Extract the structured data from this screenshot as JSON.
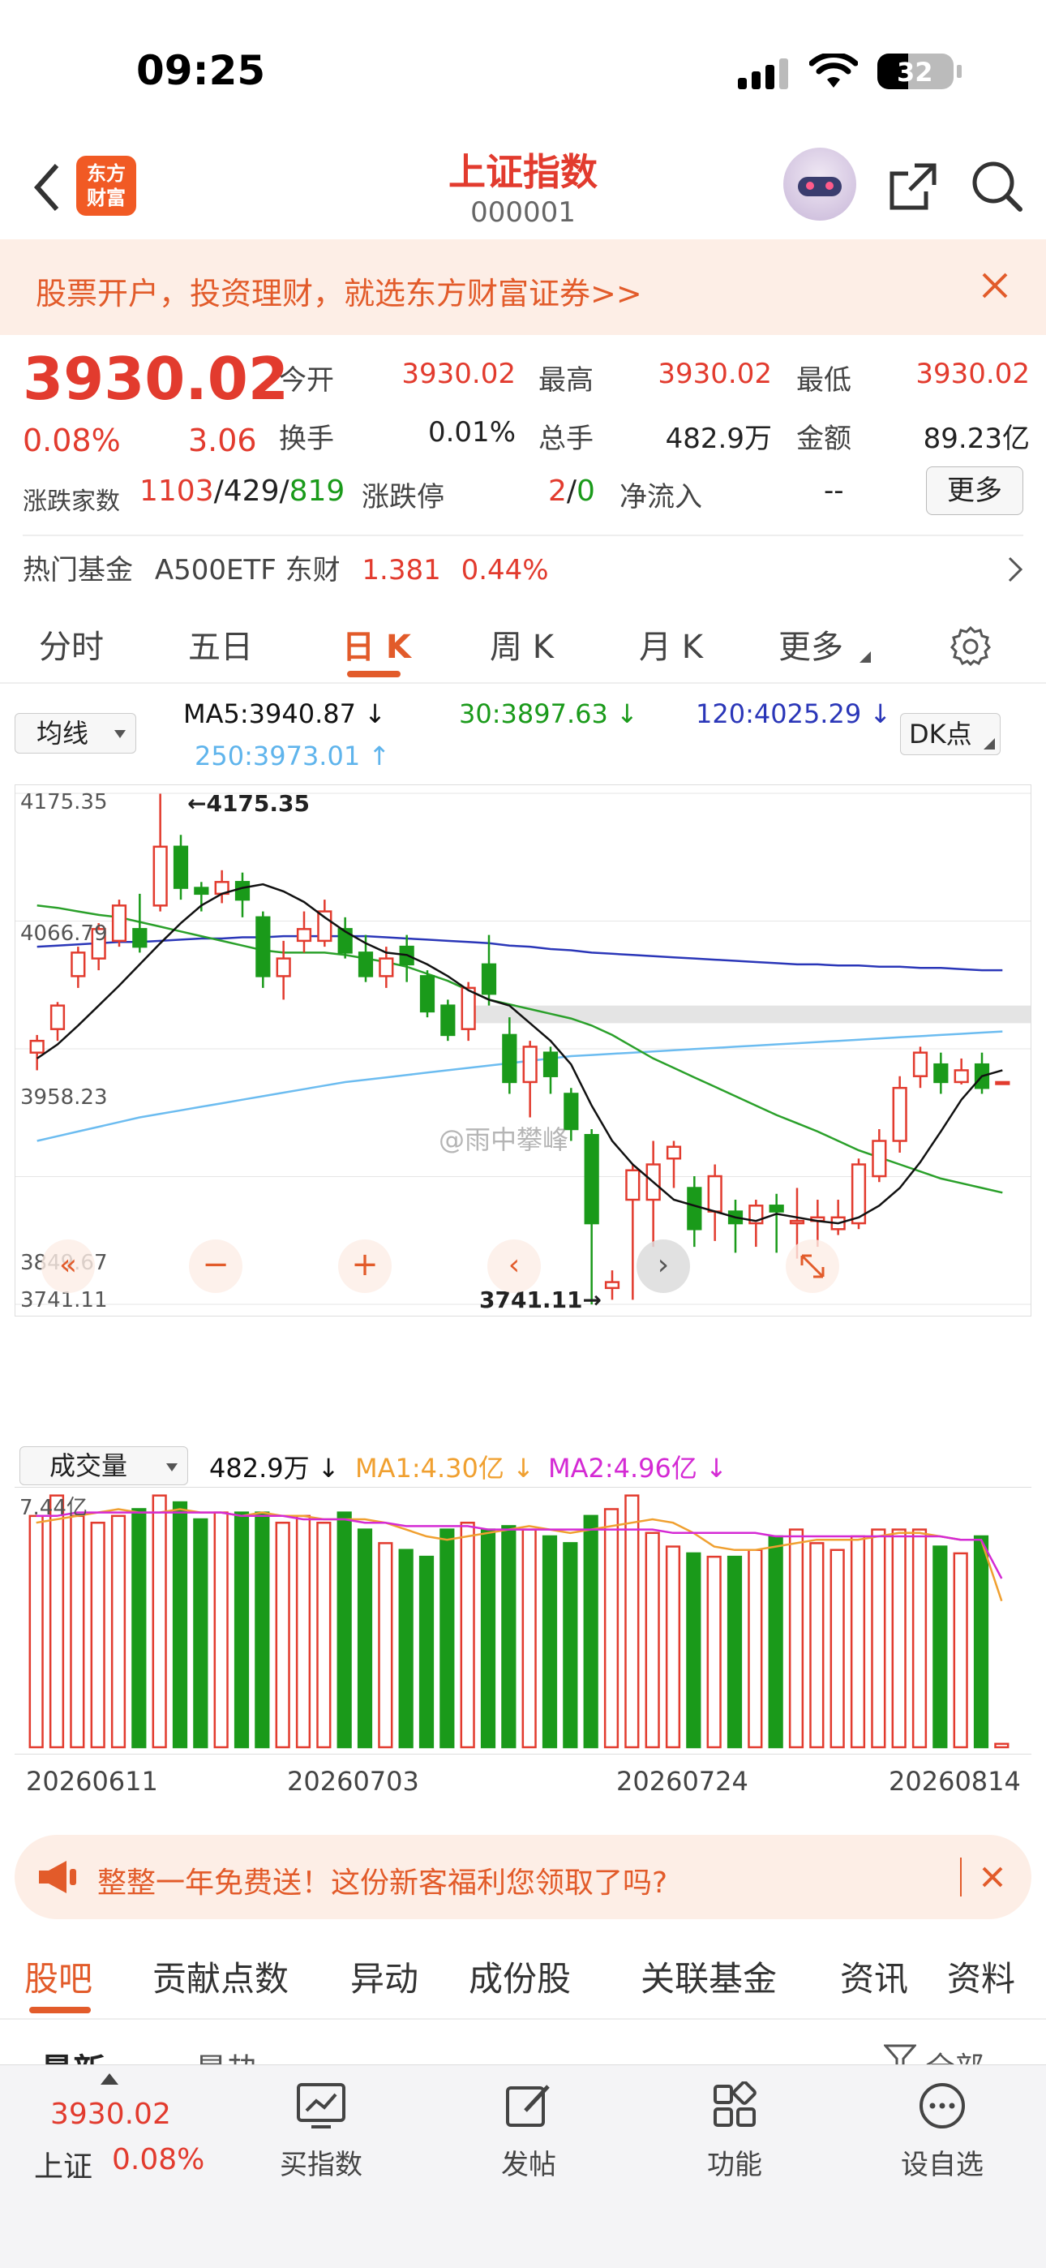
{
  "status": {
    "time": "09:25",
    "battery": "32"
  },
  "nav": {
    "title": "上证指数",
    "code": "000001",
    "logo_text": "东方财富"
  },
  "promo": {
    "text": "股票开户，投资理财，就选东方财富证券>>"
  },
  "quote": {
    "price": "3930.02",
    "pct": "0.08%",
    "change": "3.06",
    "open_label": "今开",
    "open": "3930.02",
    "high_label": "最高",
    "high": "3930.02",
    "low_label": "最低",
    "low": "3930.02",
    "turnover_label": "换手",
    "turnover": "0.01%",
    "vol_label": "总手",
    "vol": "482.9万",
    "amount_label": "金额",
    "amount": "89.23亿",
    "breadth_label": "涨跌家数",
    "up": "1103",
    "flat": "429",
    "down": "819",
    "slash": "/",
    "limit_label": "涨跌停",
    "limit_up": "2",
    "limit_down": "0",
    "inflow_label": "净流入",
    "inflow": "--",
    "more": "更多",
    "fund_label": "热门基金",
    "fund_name": "A500ETF 东财",
    "fund_price": "1.381",
    "fund_pct": "0.44%"
  },
  "tabs": [
    "分时",
    "五日",
    "日 K",
    "周 K",
    "月 K",
    "更多"
  ],
  "active_tab": "日 K",
  "chart_header": {
    "ma_select": "均线",
    "ma5": "MA5:3940.87 ↓",
    "ma30": "30:3897.63 ↓",
    "ma120": "120:4025.29 ↓",
    "ma250": "250:3973.01 ↑",
    "dk": "DK点"
  },
  "vol_header": {
    "select": "成交量",
    "vol": "482.9万 ↓",
    "ma1": "MA1:4.30亿 ↓",
    "ma2": "MA2:4.96亿 ↓"
  },
  "watermark": "@雨中攀峰",
  "colors": {
    "up": "#e23b2e",
    "down": "#1a9a1a",
    "ma5": "#111111",
    "ma30": "#2aa02a",
    "ma120": "#2a36b8",
    "ma250": "#6cbcf0"
  },
  "chart_data": {
    "type": "candlestick",
    "y_axis_labels": [
      "4175.35",
      "4066.79",
      "3958.23",
      "3849.67",
      "3741.11"
    ],
    "ylim": [
      3741.11,
      4175.35
    ],
    "max_marker": "←4175.35",
    "min_marker": "3741.11→",
    "x_labels": [
      "20260611",
      "20260703",
      "20260724",
      "20260814"
    ],
    "vol_axis_label": "7.44亿",
    "candles": [
      [
        3955,
        3965,
        3940,
        3970
      ],
      [
        3975,
        3995,
        3965,
        3998
      ],
      [
        4020,
        4040,
        4010,
        4045
      ],
      [
        4035,
        4060,
        4025,
        4065
      ],
      [
        4050,
        4080,
        4045,
        4085
      ],
      [
        4060,
        4045,
        4040,
        4090
      ],
      [
        4080,
        4130,
        4075,
        4175
      ],
      [
        4130,
        4095,
        4085,
        4140
      ],
      [
        4095,
        4090,
        4075,
        4100
      ],
      [
        4090,
        4100,
        4082,
        4110
      ],
      [
        4100,
        4085,
        4070,
        4108
      ],
      [
        4070,
        4020,
        4010,
        4075
      ],
      [
        4020,
        4035,
        4000,
        4050
      ],
      [
        4050,
        4060,
        4040,
        4075
      ],
      [
        4050,
        4075,
        4045,
        4085
      ],
      [
        4060,
        4040,
        4035,
        4070
      ],
      [
        4040,
        4020,
        4015,
        4055
      ],
      [
        4020,
        4035,
        4010,
        4045
      ],
      [
        4045,
        4030,
        4015,
        4055
      ],
      [
        4020,
        3990,
        3985,
        4025
      ],
      [
        3995,
        3970,
        3965,
        4000
      ],
      [
        3975,
        4010,
        3965,
        4015
      ],
      [
        4030,
        4005,
        3995,
        4055
      ],
      [
        3970,
        3930,
        3920,
        3985
      ],
      [
        3930,
        3960,
        3900,
        3965
      ],
      [
        3955,
        3935,
        3920,
        3960
      ],
      [
        3920,
        3890,
        3880,
        3925
      ],
      [
        3885,
        3810,
        3741,
        3890
      ],
      [
        3755,
        3760,
        3745,
        3770
      ],
      [
        3830,
        3855,
        3745,
        3860
      ],
      [
        3830,
        3860,
        3790,
        3880
      ],
      [
        3865,
        3875,
        3840,
        3880
      ],
      [
        3840,
        3805,
        3790,
        3850
      ],
      [
        3820,
        3850,
        3795,
        3860
      ],
      [
        3820,
        3810,
        3785,
        3830
      ],
      [
        3810,
        3825,
        3790,
        3830
      ],
      [
        3825,
        3820,
        3785,
        3835
      ],
      [
        3810,
        3812,
        3780,
        3840
      ],
      [
        3812,
        3815,
        3790,
        3830
      ],
      [
        3805,
        3815,
        3800,
        3830
      ],
      [
        3810,
        3860,
        3805,
        3865
      ],
      [
        3850,
        3880,
        3845,
        3890
      ],
      [
        3880,
        3925,
        3870,
        3935
      ],
      [
        3935,
        3955,
        3925,
        3960
      ],
      [
        3945,
        3930,
        3920,
        3955
      ],
      [
        3930,
        3940,
        3928,
        3950
      ],
      [
        3945,
        3925,
        3920,
        3955
      ],
      [
        3930,
        3930,
        3930,
        3930
      ]
    ],
    "ma5": [
      3950,
      3962,
      3978,
      3995,
      4012,
      4030,
      4048,
      4065,
      4080,
      4090,
      4095,
      4098,
      4092,
      4083,
      4070,
      4058,
      4048,
      4040,
      4038,
      4030,
      4020,
      4008,
      4000,
      3995,
      3980,
      3965,
      3945,
      3910,
      3880,
      3860,
      3845,
      3830,
      3825,
      3820,
      3815,
      3812,
      3818,
      3815,
      3812,
      3810,
      3815,
      3825,
      3840,
      3862,
      3888,
      3915,
      3935,
      3940
    ],
    "ma30": [
      4080,
      4078,
      4075,
      4072,
      4070,
      4066,
      4062,
      4058,
      4054,
      4050,
      4046,
      4042,
      4040,
      4040,
      4040,
      4038,
      4035,
      4032,
      4028,
      4022,
      4016,
      4008,
      4000,
      3996,
      3992,
      3988,
      3984,
      3978,
      3970,
      3960,
      3950,
      3942,
      3934,
      3926,
      3918,
      3910,
      3902,
      3895,
      3888,
      3880,
      3872,
      3866,
      3860,
      3854,
      3848,
      3844,
      3840,
      3836
    ],
    "ma120": [
      4045,
      4046,
      4047,
      4048,
      4049,
      4049,
      4050,
      4051,
      4052,
      4052,
      4053,
      4053,
      4054,
      4054,
      4054,
      4054,
      4054,
      4053,
      4052,
      4051,
      4050,
      4049,
      4048,
      4046,
      4045,
      4043,
      4042,
      4040,
      4039,
      4038,
      4037,
      4036,
      4035,
      4034,
      4033,
      4032,
      4031,
      4030,
      4030,
      4029,
      4029,
      4028,
      4028,
      4027,
      4027,
      4026,
      4025,
      4025
    ],
    "ma250": [
      3880,
      3884,
      3888,
      3892,
      3896,
      3900,
      3903,
      3906,
      3909,
      3912,
      3915,
      3918,
      3921,
      3924,
      3927,
      3930,
      3932,
      3934,
      3936,
      3938,
      3940,
      3942,
      3944,
      3946,
      3948,
      3950,
      3952,
      3953,
      3954,
      3955,
      3956,
      3957,
      3958,
      3959,
      3960,
      3961,
      3962,
      3963,
      3964,
      3965,
      3966,
      3967,
      3968,
      3969,
      3970,
      3971,
      3972,
      3973
    ],
    "volumes": [
      6.8,
      7.4,
      6.8,
      6.6,
      6.8,
      7.0,
      7.4,
      7.2,
      6.7,
      6.9,
      6.9,
      6.9,
      6.6,
      6.8,
      6.6,
      6.9,
      6.4,
      6.0,
      5.8,
      5.6,
      6.4,
      6.6,
      6.4,
      6.5,
      6.4,
      6.2,
      6.0,
      6.8,
      7.0,
      7.4,
      6.3,
      5.9,
      5.7,
      5.6,
      5.6,
      5.8,
      6.2,
      6.4,
      6.0,
      5.8,
      6.2,
      6.4,
      6.4,
      6.4,
      5.9,
      5.7,
      6.2,
      0.1
    ],
    "vol_ma1": [
      6.6,
      6.7,
      6.8,
      6.9,
      7.0,
      6.9,
      6.9,
      7.0,
      6.9,
      6.9,
      6.8,
      6.9,
      6.8,
      6.8,
      6.7,
      6.7,
      6.7,
      6.6,
      6.4,
      6.2,
      6.1,
      6.2,
      6.3,
      6.4,
      6.5,
      6.4,
      6.3,
      6.4,
      6.5,
      6.6,
      6.7,
      6.6,
      6.3,
      5.9,
      5.8,
      5.8,
      5.9,
      6.0,
      6.1,
      6.1,
      6.1,
      6.2,
      6.3,
      6.3,
      6.2,
      6.1,
      6.1,
      4.3
    ],
    "vol_ma2": [
      6.8,
      6.8,
      6.9,
      6.9,
      6.9,
      6.9,
      6.9,
      6.9,
      6.9,
      6.9,
      6.8,
      6.8,
      6.8,
      6.7,
      6.7,
      6.7,
      6.6,
      6.6,
      6.5,
      6.5,
      6.5,
      6.5,
      6.4,
      6.4,
      6.4,
      6.4,
      6.4,
      6.4,
      6.4,
      6.4,
      6.4,
      6.3,
      6.3,
      6.3,
      6.3,
      6.3,
      6.2,
      6.2,
      6.2,
      6.2,
      6.2,
      6.2,
      6.2,
      6.2,
      6.2,
      6.1,
      6.1,
      4.96
    ]
  },
  "ad": {
    "text": "整整一年免费送！这份新客福利您领取了吗?"
  },
  "guba_tabs": [
    "股吧",
    "贡献点数",
    "异动",
    "成份股",
    "关联基金",
    "资讯",
    "资料"
  ],
  "sub_tabs": {
    "latest": "最新",
    "hot": "最热",
    "all": "全部"
  },
  "bottom": {
    "price": "3930.02",
    "name": "上证",
    "pct": "0.08%",
    "buy": "买指数",
    "post": "发帖",
    "func": "功能",
    "add": "设自选"
  }
}
